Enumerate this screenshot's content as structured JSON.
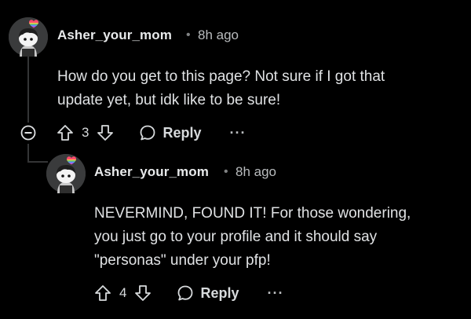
{
  "colors": {
    "background": "#000000",
    "text_primary": "#e0e2e4",
    "text_secondary": "#b9bcbe",
    "thread_line": "#343536"
  },
  "comments": [
    {
      "username": "Asher_your_mom",
      "separator": "•",
      "time": "8h ago",
      "body_lines": [
        "How do you get to this page? Not sure if I got that",
        "update yet, but idk like to be sure!"
      ],
      "votes": "3",
      "reply_label": "Reply",
      "more_label": "···",
      "avatar_icon": "snoo-avatar-icon",
      "collapse_icon": "collapse-minus-icon"
    },
    {
      "username": "Asher_your_mom",
      "separator": "•",
      "time": "8h ago",
      "body_lines": [
        "NEVERMIND, FOUND IT! For those wondering,",
        "you just go to your profile and it should say",
        "\"personas\" under your pfp!"
      ],
      "votes": "4",
      "reply_label": "Reply",
      "more_label": "···",
      "avatar_icon": "snoo-avatar-icon"
    }
  ]
}
